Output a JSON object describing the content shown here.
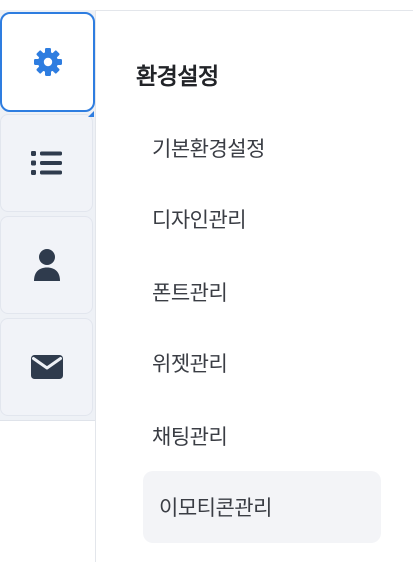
{
  "rail": {
    "tabs": [
      {
        "icon": "gear-icon",
        "active": true
      },
      {
        "icon": "list-icon",
        "active": false
      },
      {
        "icon": "user-icon",
        "active": false
      },
      {
        "icon": "envelope-icon",
        "active": false
      }
    ]
  },
  "panel": {
    "title": "환경설정",
    "items": [
      {
        "label": "기본환경설정"
      },
      {
        "label": "디자인관리"
      },
      {
        "label": "폰트관리"
      },
      {
        "label": "위젯관리"
      },
      {
        "label": "채팅관리"
      },
      {
        "label": "이모티콘관리",
        "selected": true
      }
    ]
  },
  "colors": {
    "accent": "#2e7de0",
    "icon_dark": "#2f3b4d",
    "rail_bg": "#eef1f6",
    "selected_bg": "#f3f4f7"
  }
}
